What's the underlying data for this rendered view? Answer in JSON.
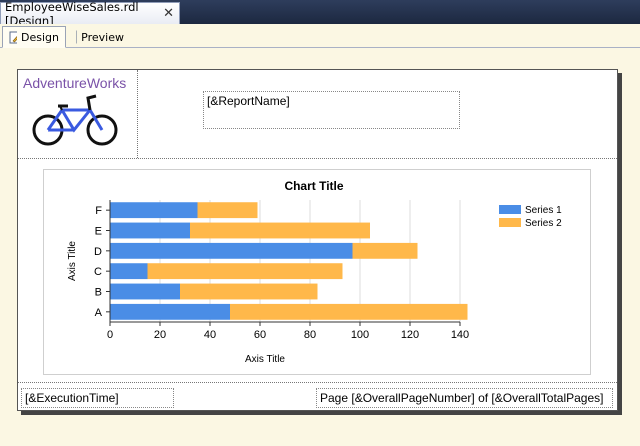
{
  "tab": {
    "title": "EmployeeWiseSales.rdl [Design]",
    "close": "✕"
  },
  "viewtabs": {
    "design": "Design",
    "preview": "Preview"
  },
  "report": {
    "logo_text": "AdventureWorks",
    "report_name": "[&ReportName]",
    "execution_time": "[&ExecutionTime]",
    "page_number": "Page [&OverallPageNumber] of [&OverallTotalPages]"
  },
  "colors": {
    "series1": "#4a8de6",
    "series2": "#ffb84a"
  },
  "chart_data": {
    "type": "bar",
    "orientation": "horizontal",
    "title": "Chart Title",
    "xlabel": "Axis Title",
    "ylabel": "Axis Title",
    "categories": [
      "A",
      "B",
      "C",
      "D",
      "E",
      "F"
    ],
    "series": [
      {
        "name": "Series 1",
        "values": [
          48,
          28,
          15,
          97,
          32,
          35
        ]
      },
      {
        "name": "Series 2",
        "values": [
          95,
          55,
          78,
          26,
          72,
          24
        ]
      }
    ],
    "stacked": true,
    "xlim": [
      0,
      140
    ],
    "xticks": [
      0,
      20,
      40,
      60,
      80,
      100,
      120,
      140
    ],
    "grid": "vertical",
    "legend": "top-right"
  }
}
